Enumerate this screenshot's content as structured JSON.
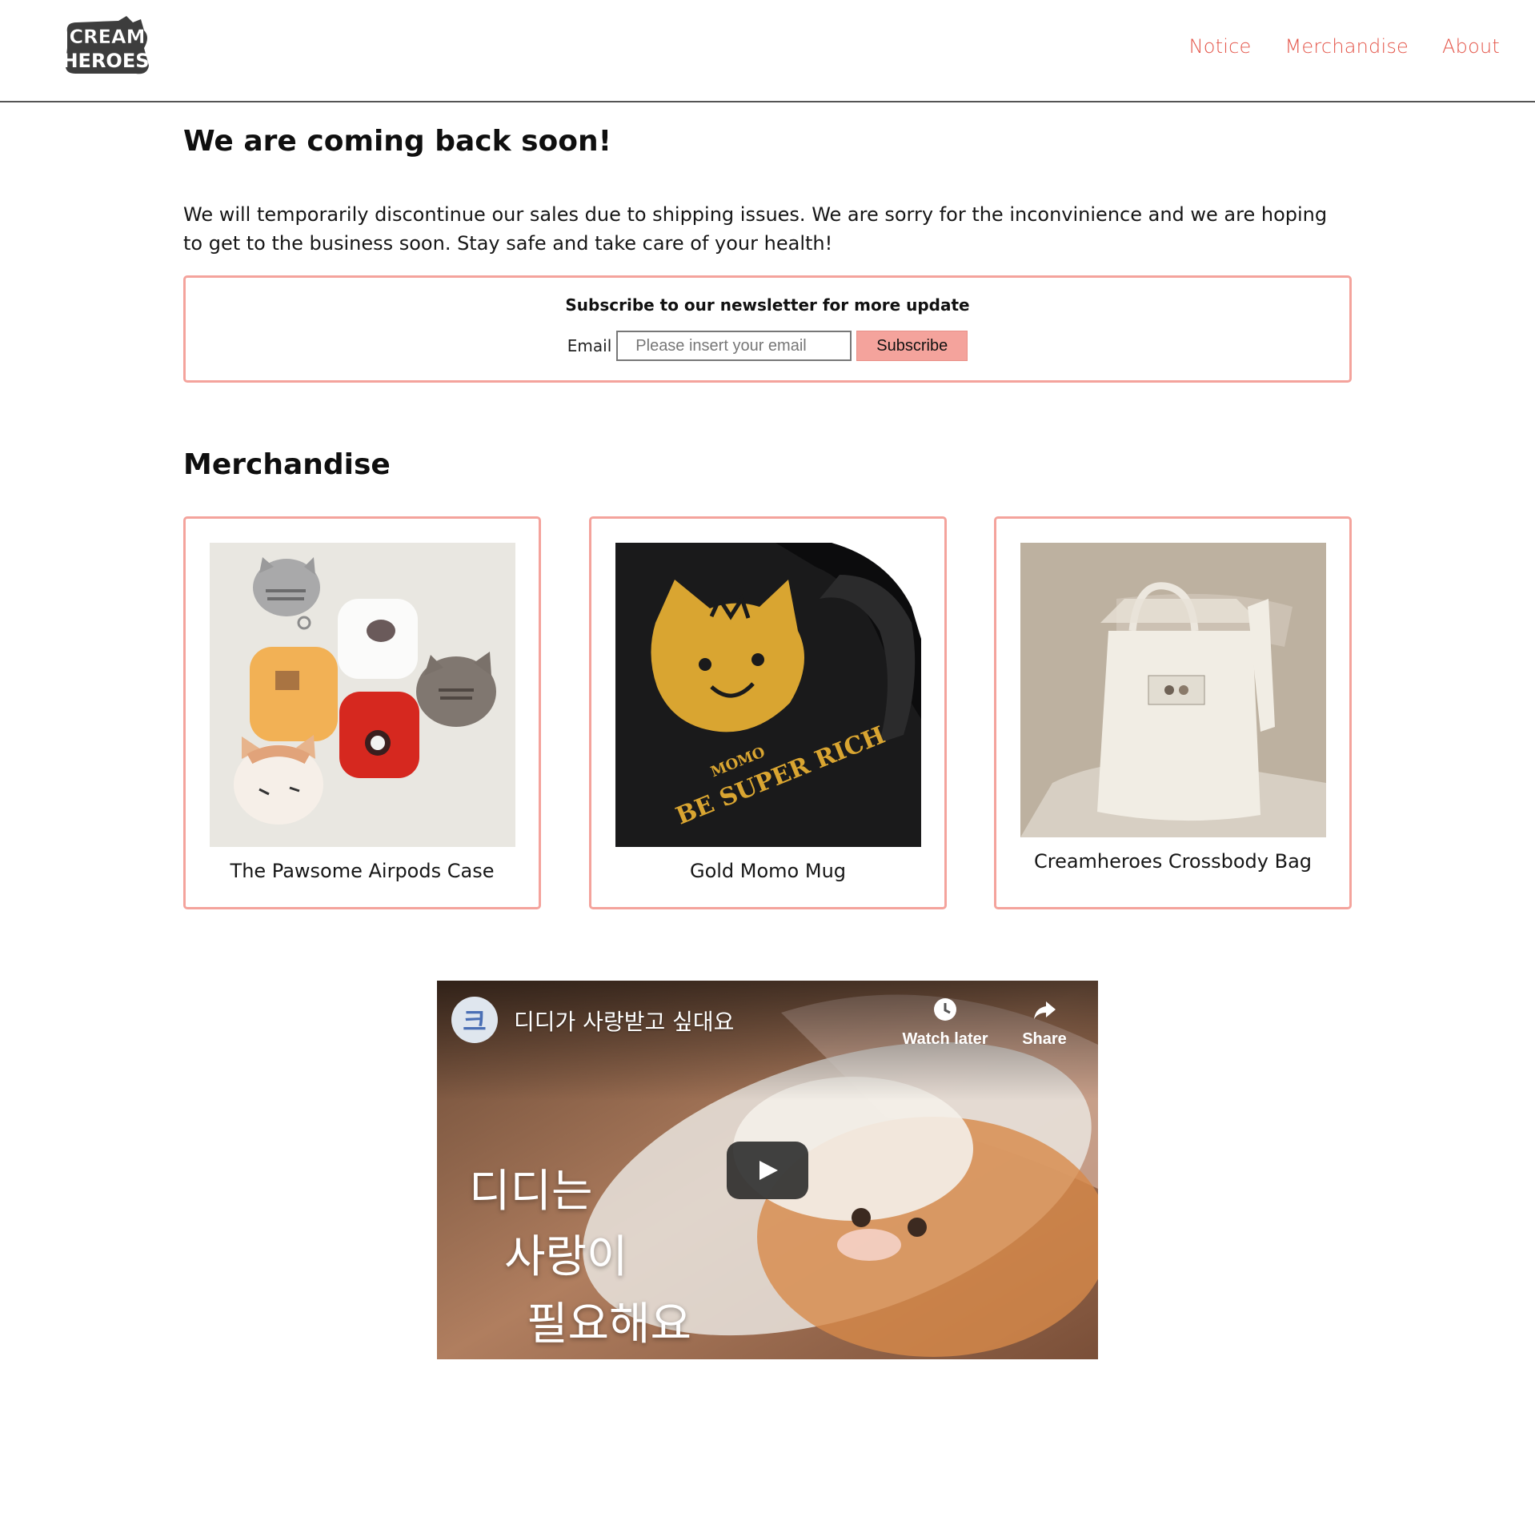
{
  "header": {
    "logo_text_top": "CREAM",
    "logo_text_bottom": "HEROES",
    "nav": [
      "Notice",
      "Merchandise",
      "About"
    ]
  },
  "notice": {
    "title": "We are coming back soon!",
    "body": "We will temporarily discontinue our sales due to shipping issues. We are sorry for the inconvinience and we are hoping to get to the business soon. Stay safe and take care of your health!"
  },
  "newsletter": {
    "title": "Subscribe to our newsletter for more update",
    "email_label": "Email",
    "email_placeholder": "Please insert your email",
    "submit_label": "Subscribe"
  },
  "merchandise": {
    "title": "Merchandise",
    "items": [
      {
        "name": "The Pawsome Airpods Case"
      },
      {
        "name": "Gold Momo Mug",
        "print_text_1": "BE SUPER RICH",
        "print_text_2": "MOMO"
      },
      {
        "name": "Creamheroes Crossbody Bag"
      }
    ]
  },
  "video": {
    "channel_initial": "크",
    "title": "디디가 사랑받고 싶대요",
    "watch_later": "Watch later",
    "share": "Share",
    "overlay_line1": "디디는",
    "overlay_line2": "사랑이",
    "overlay_line3": "필요해요"
  },
  "colors": {
    "accent": "#e4564a",
    "card_border": "#f4a39c",
    "button_bg": "#f4a39c"
  }
}
